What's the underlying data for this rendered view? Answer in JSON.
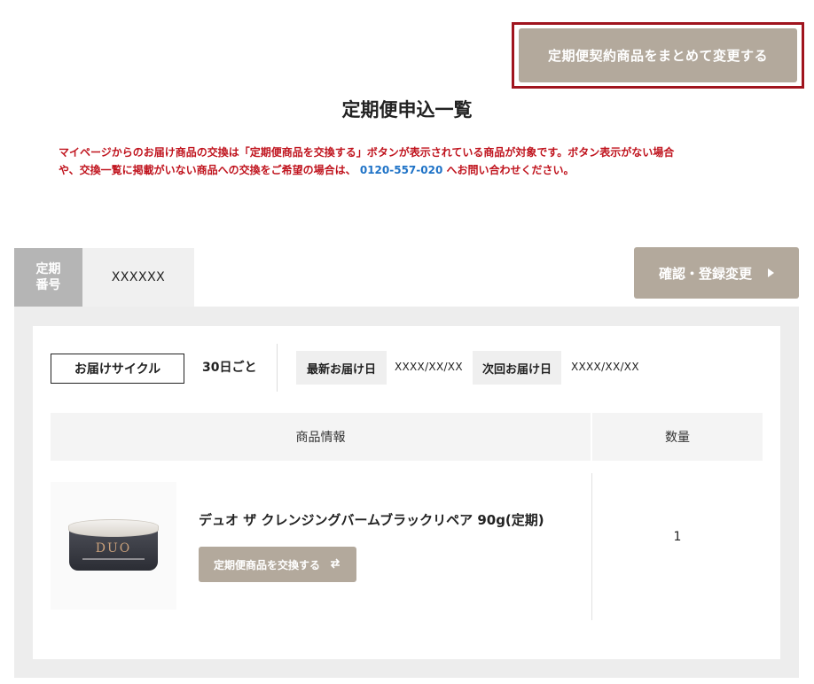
{
  "bulk_change_label": "定期便契約商品をまとめて変更する",
  "page_title": "定期便申込一覧",
  "notice": {
    "line1": "マイページからのお届け商品の交換は「定期便商品を交換する」ボタンが表示されている商品が対象です。ボタン表示がない場合",
    "line2_pre": "や、交換一覧に掲載がいない商品への交換をご希望の場合は、",
    "phone": "0120-557-020",
    "line2_post": "へお問い合わせください。"
  },
  "contract": {
    "label": "定期 番号",
    "label_line1": "定期",
    "label_line2": "番号",
    "number": "XXXXXX",
    "confirm_label": "確認・登録変更"
  },
  "delivery": {
    "cycle_label": "お届けサイクル",
    "cycle_value": "30日ごと",
    "latest_label": "最新お届け日",
    "latest_value": "XXXX/XX/XX",
    "next_label": "次回お届け日",
    "next_value": "XXXX/XX/XX"
  },
  "table": {
    "headers": [
      "商品情報",
      "数量"
    ],
    "rows": [
      {
        "product_name": "デュオ ザ クレンジングバームブラックリペア 90g(定期)",
        "exchange_label": "定期便商品を交換する",
        "quantity": "1",
        "image_brand": "DUO"
      }
    ]
  },
  "colors": {
    "accent_button": "#b3a99c",
    "notice_red": "#c0141e",
    "phone_blue": "#1f73c7",
    "highlight_border": "#a0141e"
  }
}
